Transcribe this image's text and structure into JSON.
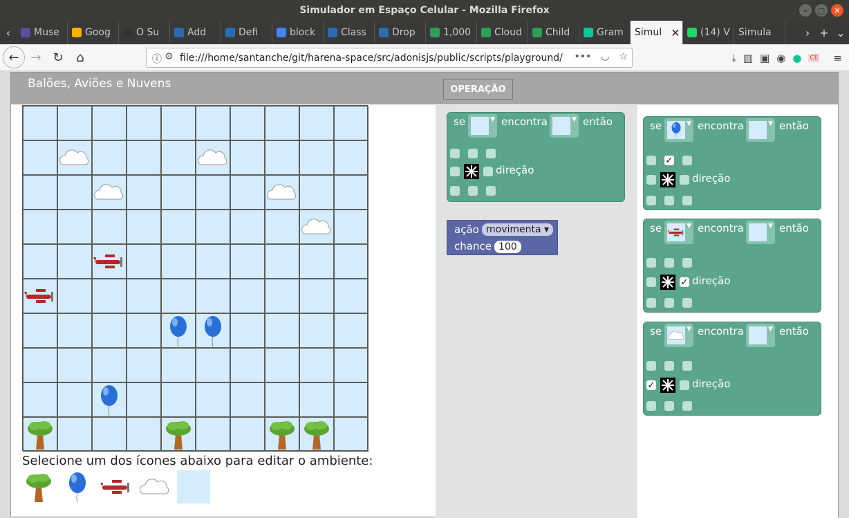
{
  "window": {
    "title": "Simulador em Espaço Celular - Mozilla Firefox"
  },
  "tabs": [
    {
      "label": "Muse",
      "fav": "#5b4ea0",
      "icon": "bars-icon"
    },
    {
      "label": "Goog",
      "fav": "#f4b400",
      "icon": "bulb-icon"
    },
    {
      "label": "O Su",
      "fav": "#333333",
      "icon": "plane-icon"
    },
    {
      "label": "Add",
      "fav": "#2b6cb0",
      "icon": "code-icon"
    },
    {
      "label": "Defi",
      "fav": "#2b6cb0",
      "icon": "code-icon"
    },
    {
      "label": "block",
      "fav": "#4285f4",
      "icon": "google-icon"
    },
    {
      "label": "Class",
      "fav": "#2b6cb0",
      "icon": "code-icon"
    },
    {
      "label": "Drop",
      "fav": "#2b6cb0",
      "icon": "code-icon"
    },
    {
      "label": "1,000",
      "fav": "#2e9e5b",
      "icon": "px-icon"
    },
    {
      "label": "Cloud",
      "fav": "#2e9e5b",
      "icon": "px-icon"
    },
    {
      "label": "Child",
      "fav": "#2e9e5b",
      "icon": "px-icon"
    },
    {
      "label": "Gram",
      "fav": "#15c39a",
      "icon": "grammarly-icon"
    },
    {
      "label": "Simul",
      "fav": "",
      "icon": "",
      "active": true
    },
    {
      "label": "(14) V",
      "fav": "#25d366",
      "icon": "whatsapp-icon"
    },
    {
      "label": "Simula",
      "fav": "",
      "icon": ""
    }
  ],
  "nav": {
    "url": "file:///home/santanche/git/harena-space/src/adonisjs/public/scripts/playground/"
  },
  "app": {
    "title": "Balões, Aviões e Nuvens",
    "operation_button": "OPERAÇÃO",
    "selector_label": "Selecione um dos ícones abaixo para editar o ambiente:"
  },
  "environment_grid": {
    "rows": 10,
    "cols": 10,
    "objects": [
      {
        "type": "cloud",
        "row": 1,
        "col": 1
      },
      {
        "type": "cloud",
        "row": 1,
        "col": 5
      },
      {
        "type": "cloud",
        "row": 2,
        "col": 2
      },
      {
        "type": "cloud",
        "row": 2,
        "col": 7
      },
      {
        "type": "cloud",
        "row": 3,
        "col": 8
      },
      {
        "type": "plane",
        "row": 4,
        "col": 2
      },
      {
        "type": "plane",
        "row": 5,
        "col": 0
      },
      {
        "type": "balloon",
        "row": 6,
        "col": 4
      },
      {
        "type": "balloon",
        "row": 6,
        "col": 5
      },
      {
        "type": "balloon",
        "row": 8,
        "col": 2
      },
      {
        "type": "tree",
        "row": 9,
        "col": 0
      },
      {
        "type": "tree",
        "row": 9,
        "col": 4
      },
      {
        "type": "tree",
        "row": 9,
        "col": 7
      },
      {
        "type": "tree",
        "row": 9,
        "col": 8
      }
    ]
  },
  "palette": [
    "tree",
    "balloon",
    "plane",
    "cloud",
    "empty"
  ],
  "blocks": {
    "if_label": "se",
    "meets_label": "encontra",
    "then_label": "então",
    "direction_label": "direção",
    "action_label": "ação",
    "action_value": "movimenta",
    "chance_label": "chance",
    "chance_value": "100"
  },
  "rules": [
    {
      "agent": "balloon",
      "target": "empty",
      "checked": "center-top"
    },
    {
      "agent": "plane",
      "target": "empty",
      "checked": "right"
    },
    {
      "agent": "cloud",
      "target": "empty",
      "checked": "left"
    }
  ]
}
